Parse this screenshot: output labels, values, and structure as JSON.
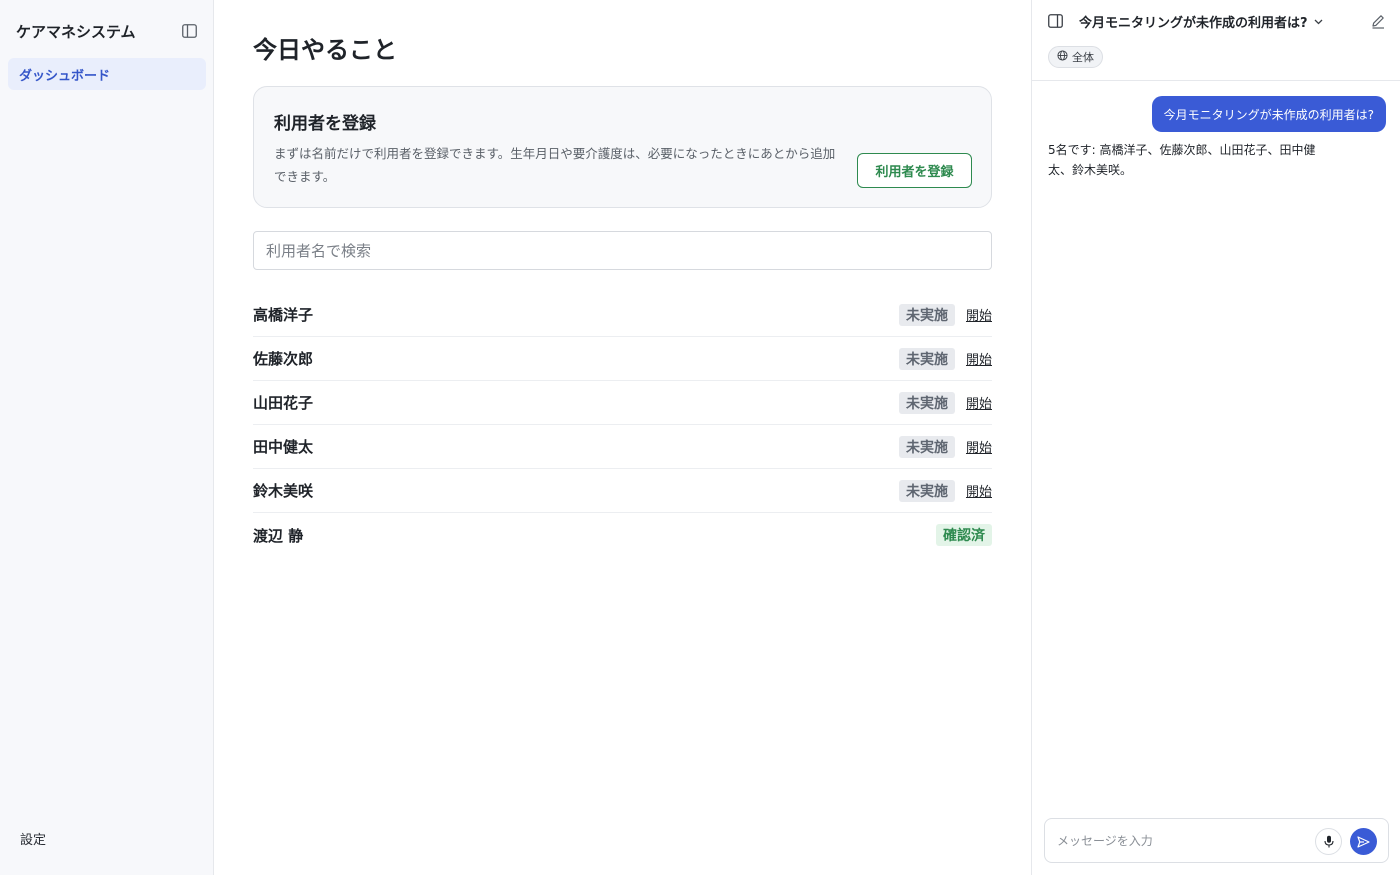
{
  "sidebar": {
    "app_title": "ケアマネシステム",
    "collapse_icon": "sidebar-toggle-icon",
    "nav_items": [
      {
        "label": "ダッシュボード",
        "active": true
      }
    ],
    "settings_label": "設定"
  },
  "main": {
    "title": "今日やること",
    "register_card": {
      "title": "利用者を登録",
      "description": "まずは名前だけで利用者を登録できます。生年月日や要介護度は、必要になったときにあとから追加できます。",
      "button_label": "利用者を登録"
    },
    "search": {
      "placeholder": "利用者名で検索",
      "value": ""
    },
    "clients": [
      {
        "name": "高橋洋子",
        "status": "未実施",
        "status_type": "pending",
        "action": "開始"
      },
      {
        "name": "佐藤次郎",
        "status": "未実施",
        "status_type": "pending",
        "action": "開始"
      },
      {
        "name": "山田花子",
        "status": "未実施",
        "status_type": "pending",
        "action": "開始"
      },
      {
        "name": "田中健太",
        "status": "未実施",
        "status_type": "pending",
        "action": "開始"
      },
      {
        "name": "鈴木美咲",
        "status": "未実施",
        "status_type": "pending",
        "action": "開始"
      },
      {
        "name": "渡辺 静",
        "status": "確認済",
        "status_type": "done",
        "action": ""
      }
    ]
  },
  "chat": {
    "title": "今月モニタリングが未作成の利用者は?",
    "scope_label": "全体",
    "messages": [
      {
        "role": "user",
        "text": "今月モニタリングが未作成の利用者は?"
      },
      {
        "role": "assistant",
        "text": "5名です: 高橋洋子、佐藤次郎、山田花子、田中健太、鈴木美咲。"
      }
    ],
    "composer": {
      "placeholder": "メッセージを入力",
      "value": ""
    }
  },
  "colors": {
    "accent": "#3a5bd6",
    "success": "#2e8a4f",
    "nav_active_bg": "#e9eefc",
    "badge_pending_bg": "#e8eaee",
    "badge_done_bg": "#e3f4e8"
  }
}
